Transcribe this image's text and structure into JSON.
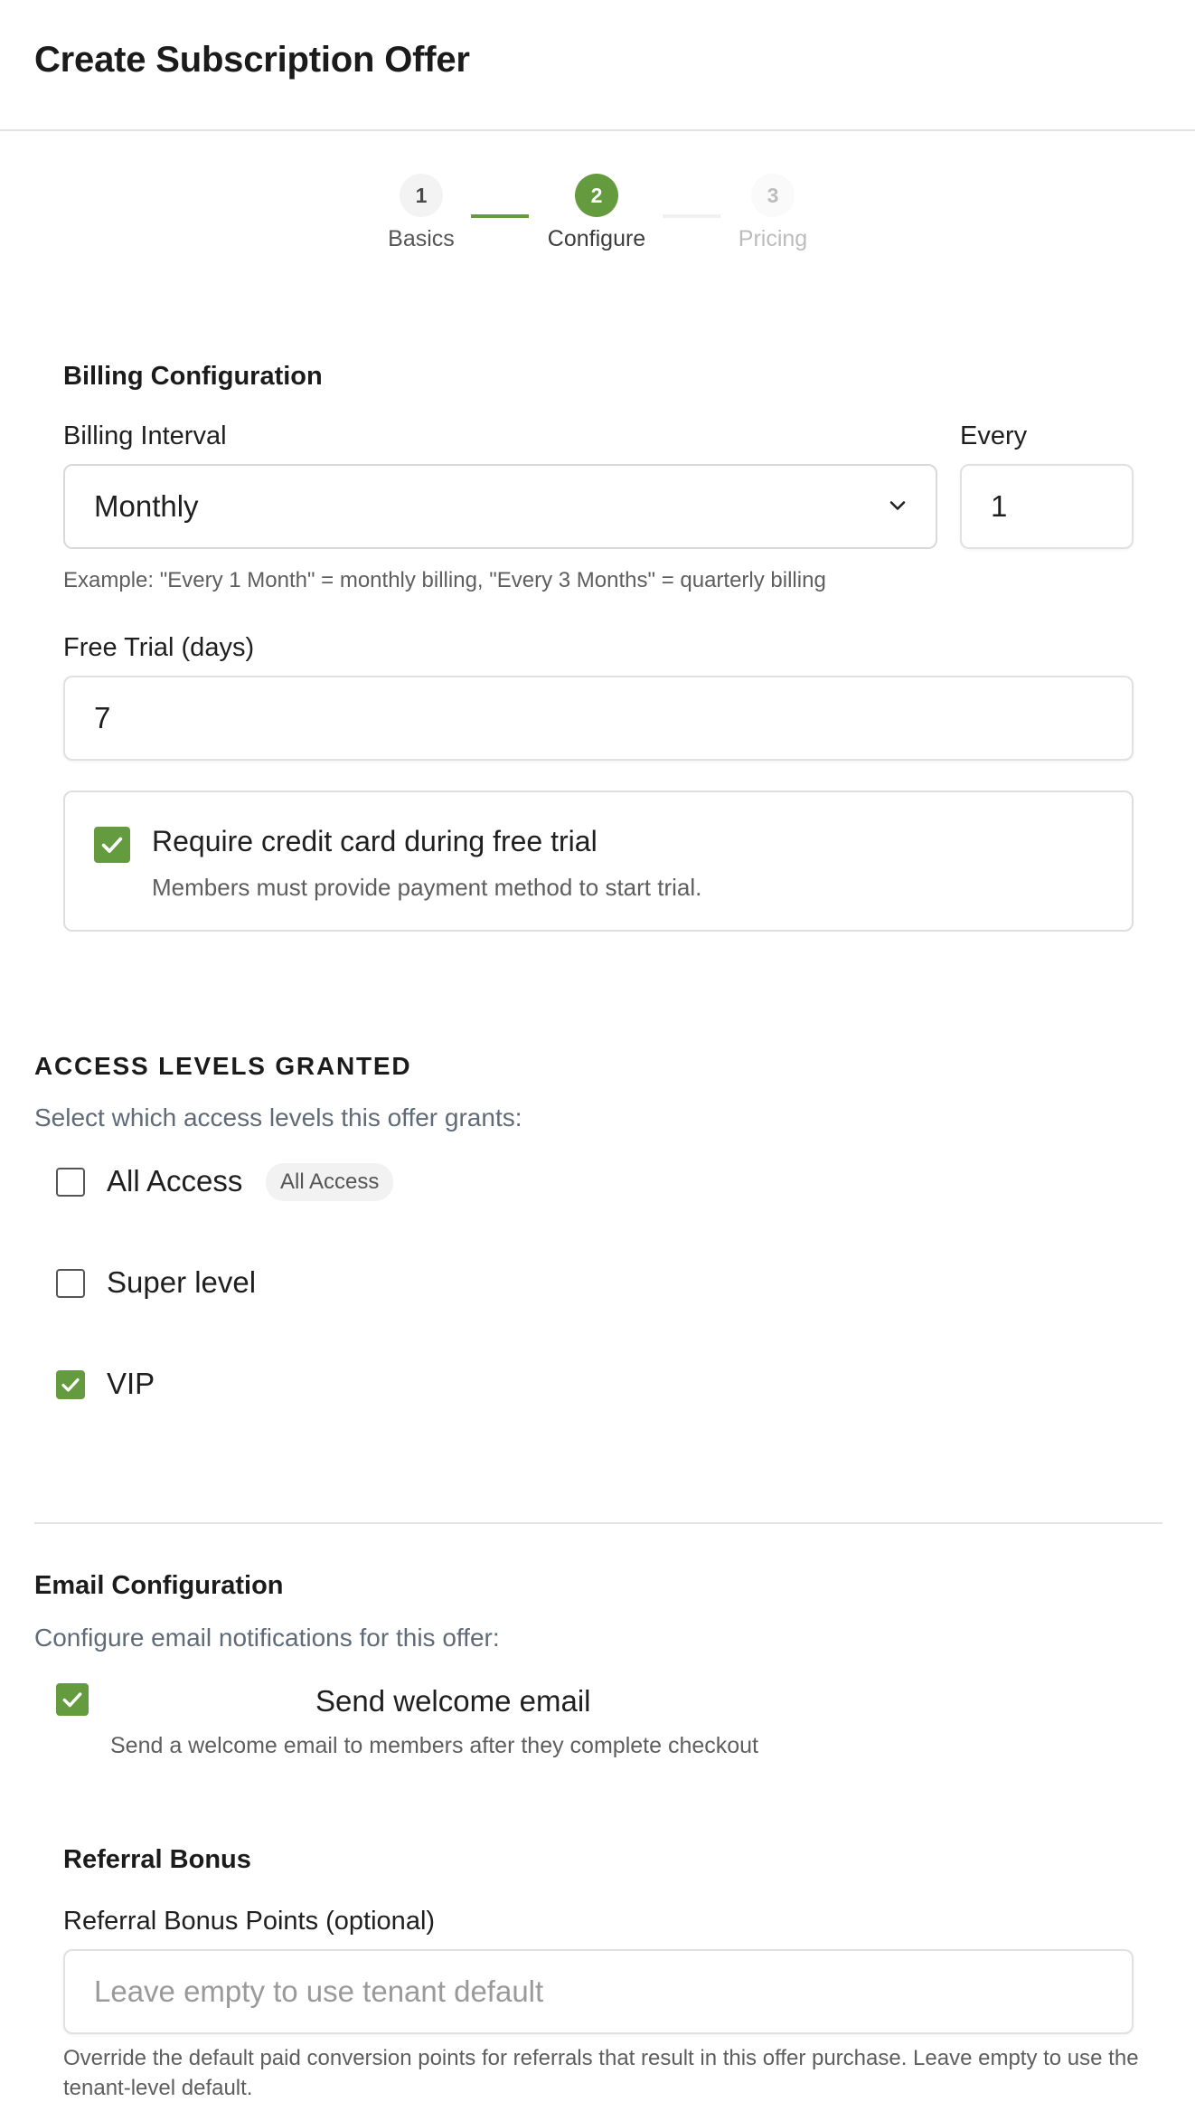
{
  "header": {
    "title": "Create Subscription Offer"
  },
  "stepper": {
    "steps": [
      {
        "number": "1",
        "label": "Basics",
        "state": "done"
      },
      {
        "number": "2",
        "label": "Configure",
        "state": "active"
      },
      {
        "number": "3",
        "label": "Pricing",
        "state": "upcoming"
      }
    ]
  },
  "billing": {
    "heading": "Billing Configuration",
    "interval_label": "Billing Interval",
    "interval_value": "Monthly",
    "every_label": "Every",
    "every_value": "1",
    "example_text": "Example: \"Every 1 Month\" = monthly billing, \"Every 3 Months\" = quarterly billing",
    "trial_label": "Free Trial (days)",
    "trial_value": "7",
    "credit_card_label": "Require credit card during free trial",
    "credit_card_help": "Members must provide payment method to start trial.",
    "credit_card_checked": true
  },
  "access": {
    "heading": "ACCESS LEVELS GRANTED",
    "subtitle": "Select which access levels this offer grants:",
    "levels": [
      {
        "label": "All Access",
        "badge": "All Access",
        "checked": false
      },
      {
        "label": "Super level",
        "checked": false
      },
      {
        "label": "VIP",
        "checked": true
      }
    ]
  },
  "email": {
    "heading": "Email Configuration",
    "subtitle": "Configure email notifications for this offer:",
    "welcome_label": "Send welcome email",
    "welcome_help": "Send a welcome email to members after they complete checkout",
    "welcome_checked": true
  },
  "referral": {
    "heading": "Referral Bonus",
    "points_label": "Referral Bonus Points (optional)",
    "points_placeholder": "Leave empty to use tenant default",
    "help_text": "Override the default paid conversion points for referrals that result in this offer purchase. Leave empty to use the tenant-level default."
  },
  "colors": {
    "accent": "#659b3f",
    "border": "#d9d9d9",
    "muted_text": "#5f6b77"
  },
  "icons": {
    "check": "check-icon",
    "chevron": "chevron-down-icon"
  }
}
